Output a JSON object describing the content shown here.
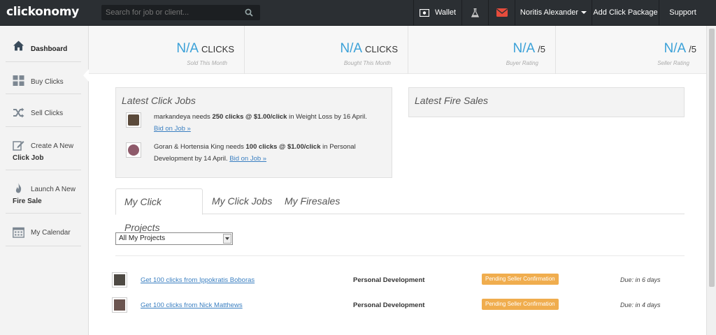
{
  "app": {
    "logo": "clickonomy"
  },
  "search": {
    "placeholder": "Search for job or client..."
  },
  "nav": {
    "wallet": "Wallet",
    "user": "Noritis Alexander",
    "add_package": "Add Click Package",
    "support": "Support"
  },
  "sidebar": {
    "items": [
      {
        "label": "Dashboard",
        "icon": "home-icon"
      },
      {
        "label": "Buy Clicks",
        "icon": "grid-icon"
      },
      {
        "label": "Sell Clicks",
        "icon": "shuffle-icon"
      },
      {
        "label": "Create A New",
        "label2": "Click Job",
        "icon": "edit-icon"
      },
      {
        "label": "Launch A New",
        "label2": "Fire Sale",
        "icon": "fire-icon"
      },
      {
        "label": "My Calendar",
        "icon": "calendar-icon"
      }
    ]
  },
  "stats": [
    {
      "value": "N/A",
      "unit": "CLICKS",
      "caption": "Sold This Month"
    },
    {
      "value": "N/A",
      "unit": "CLICKS",
      "caption": "Bought This Month"
    },
    {
      "value": "N/A",
      "unit": "/5",
      "caption": "Buyer Rating"
    },
    {
      "value": "N/A",
      "unit": "/5",
      "caption": "Seller Rating"
    }
  ],
  "latest_jobs": {
    "title": "Latest Click Jobs",
    "items": [
      {
        "user": "markandeya",
        "needs": " needs ",
        "amount": "250 clicks @ $1.00/click",
        "rest": " in Weight Loss by 16 April.",
        "bid": "Bid on Job »"
      },
      {
        "user": "Goran & Hortensia King",
        "needs": " needs ",
        "amount": "100 clicks @ $1.00/click",
        "rest": " in Personal Development by 14 April. ",
        "bid": "Bid on Job »"
      }
    ]
  },
  "fire_sales": {
    "title": "Latest Fire Sales"
  },
  "tabs": [
    "My Click Projects",
    "My Click Jobs",
    "My Firesales"
  ],
  "filter": {
    "selected": "All My Projects"
  },
  "projects": [
    {
      "title": "Get 100 clicks from Ippokratis Boboras",
      "category": "Personal Development",
      "status": "Pending Seller Confirmation",
      "due": "Due: in 6 days"
    },
    {
      "title": "Get 100 clicks from Nick Matthews",
      "category": "Personal Development",
      "status": "Pending Seller Confirmation",
      "due": "Due: in 4 days"
    }
  ],
  "colors": {
    "accent": "#3ba1d8",
    "badge": "#f0ad4e",
    "topbar": "#2b2f33",
    "mail": "#e74c3c"
  }
}
